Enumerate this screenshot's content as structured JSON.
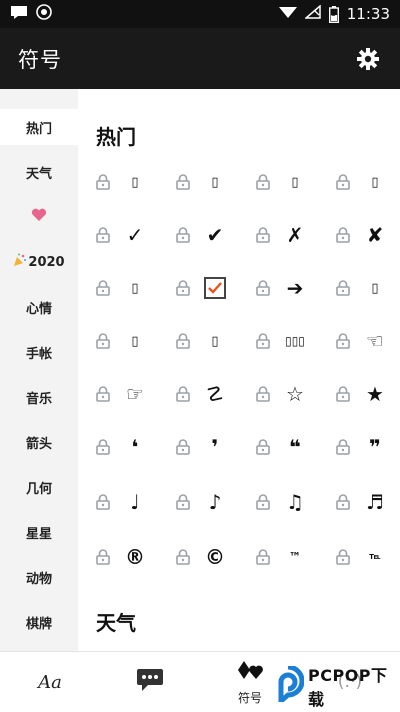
{
  "status_bar": {
    "time": "11:33",
    "battery": "5"
  },
  "app_bar": {
    "title": "符号"
  },
  "sidebar": {
    "items": [
      {
        "label": "热门",
        "active": true
      },
      {
        "label": "天气"
      },
      {
        "label": "",
        "icon": "heart-icon"
      },
      {
        "label": "2020",
        "icon": "party-popper-icon"
      },
      {
        "label": "心情"
      },
      {
        "label": "手帐"
      },
      {
        "label": "音乐"
      },
      {
        "label": "箭头"
      },
      {
        "label": "几何"
      },
      {
        "label": "星星"
      },
      {
        "label": "动物"
      },
      {
        "label": "棋牌"
      }
    ]
  },
  "sections": [
    {
      "title": "热门",
      "symbols": [
        "▯",
        "▯",
        "▯",
        "▯",
        "✓",
        "✔",
        "✗",
        "✘",
        "▯",
        "☑",
        "➔",
        "▯",
        "▯",
        "▯",
        "▯▯▯",
        "☜",
        "☞",
        "☡",
        "☆",
        "★",
        "❛",
        "❜",
        "❝",
        "❞",
        "♩",
        "♪",
        "♫",
        "♬",
        "®",
        "©",
        "™",
        "℡"
      ]
    },
    {
      "title": "天气"
    }
  ],
  "bottom_nav": {
    "items": [
      {
        "label": "",
        "text": "Aa"
      },
      {
        "label": "",
        "icon": "speech-bubble-icon"
      },
      {
        "label": "符号",
        "icon": "cards-icon"
      },
      {
        "label": "",
        "text": "(:·)"
      }
    ]
  },
  "watermark": {
    "text": "PCPOP下载"
  },
  "colors": {
    "app_bar": "#1a1a1a",
    "sidebar_bg": "#f3f3f3",
    "checkbox_mark": "#e6541f",
    "lock": "#9aa1a8"
  }
}
